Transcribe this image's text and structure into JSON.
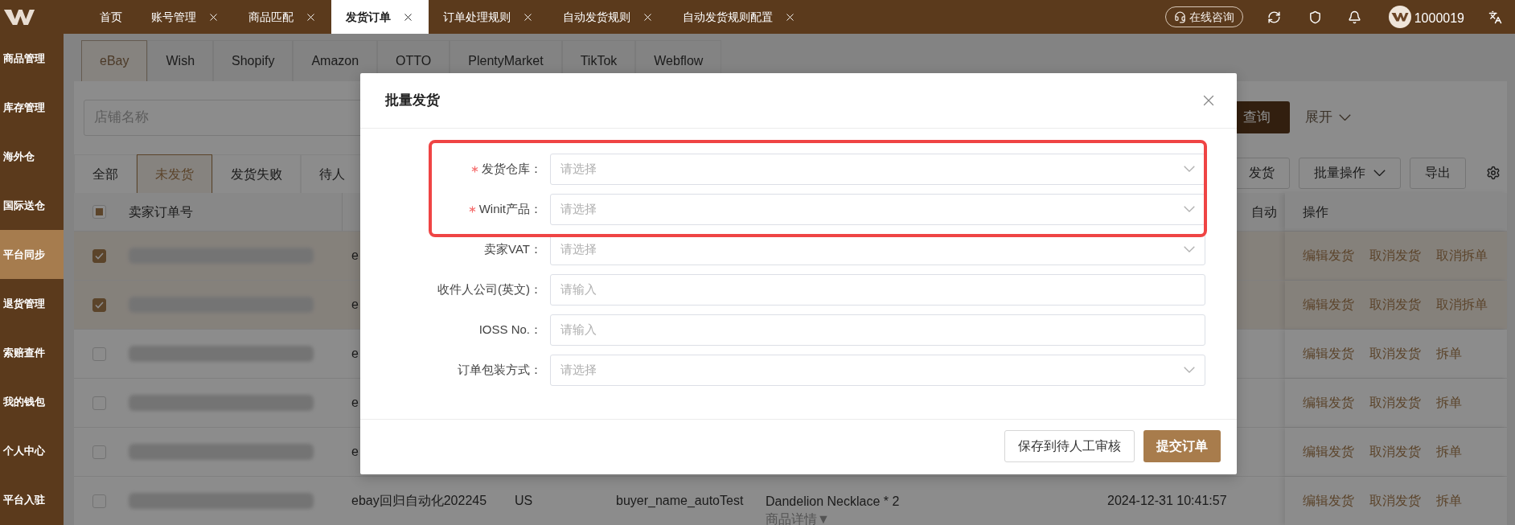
{
  "header": {
    "tabs": [
      {
        "label": "首页",
        "closable": false,
        "selected": false
      },
      {
        "label": "账号管理",
        "closable": true,
        "selected": false
      },
      {
        "label": "商品匹配",
        "closable": true,
        "selected": false
      },
      {
        "label": "发货订单",
        "closable": true,
        "selected": true
      },
      {
        "label": "订单处理规则",
        "closable": true,
        "selected": false
      },
      {
        "label": "自动发货规则",
        "closable": true,
        "selected": false
      },
      {
        "label": "自动发货规则配置",
        "closable": true,
        "selected": false
      }
    ],
    "consult_button": "在线咨询",
    "user_id": "1000019"
  },
  "sidebar": {
    "items": [
      {
        "label": "商品管理",
        "selected": false
      },
      {
        "label": "库存管理",
        "selected": false
      },
      {
        "label": "海外仓",
        "selected": false
      },
      {
        "label": "国际送仓",
        "selected": false
      },
      {
        "label": "平台同步",
        "selected": true
      },
      {
        "label": "退货管理",
        "selected": false
      },
      {
        "label": "索赔查件",
        "selected": false
      },
      {
        "label": "我的钱包",
        "selected": false
      },
      {
        "label": "个人中心",
        "selected": false
      },
      {
        "label": "平台入驻",
        "selected": false
      }
    ]
  },
  "platform_tabs": [
    {
      "label": "eBay",
      "selected": true
    },
    {
      "label": "Wish",
      "selected": false
    },
    {
      "label": "Shopify",
      "selected": false
    },
    {
      "label": "Amazon",
      "selected": false
    },
    {
      "label": "OTTO",
      "selected": false
    },
    {
      "label": "PlentyMarket",
      "selected": false
    },
    {
      "label": "TikTok",
      "selected": false
    },
    {
      "label": "Webflow",
      "selected": false
    }
  ],
  "search": {
    "placeholder": "店铺名称",
    "query_button": "查询",
    "expand_button": "展开"
  },
  "status_tabs": [
    {
      "label": "全部",
      "selected": false
    },
    {
      "label": "未发货",
      "selected": true
    },
    {
      "label": "发货失败",
      "selected": false
    },
    {
      "label": "待人",
      "selected": false
    }
  ],
  "toolbar": [
    {
      "label": "发货",
      "kind": "plain"
    },
    {
      "label": "批量操作",
      "kind": "dropdown"
    },
    {
      "label": "导出",
      "kind": "plain"
    }
  ],
  "table": {
    "select_all_partial": true,
    "columns": [
      {
        "label": "卖家订单号",
        "kind": "order"
      },
      {
        "label": "自动",
        "kind": "auto"
      },
      {
        "label": "操作",
        "kind": "actions"
      }
    ],
    "rows": [
      {
        "checked": true,
        "shop": "e",
        "actions": [
          "编辑发货",
          "取消发货",
          "取消拆单"
        ]
      },
      {
        "checked": true,
        "shop": "e",
        "actions": [
          "编辑发货",
          "取消发货",
          "取消拆单"
        ]
      },
      {
        "checked": false,
        "shop": "e",
        "actions": [
          "编辑发货",
          "取消发货",
          "拆单"
        ]
      },
      {
        "checked": false,
        "shop": "e",
        "actions": [
          "编辑发货",
          "取消发货",
          "拆单"
        ]
      },
      {
        "checked": false,
        "shop": "e",
        "actions": [
          "编辑发货",
          "取消发货",
          "拆单"
        ]
      },
      {
        "checked": false,
        "shop": "ebay回归自动化202245",
        "country": "US",
        "buyer": "buyer_name_autoTest",
        "product": "Dandelion Necklace * 2",
        "detail_link": "商品详情▼",
        "date": "2024-12-31 10:41:57",
        "actions": [
          "编辑发货",
          "取消发货",
          "拆单"
        ]
      }
    ]
  },
  "dialog": {
    "title": "批量发货",
    "fields": [
      {
        "label": "发货仓库：",
        "required": true,
        "highlighted": true,
        "kind": "select",
        "placeholder": "请选择"
      },
      {
        "label": "Winit产品：",
        "required": true,
        "highlighted": true,
        "kind": "select",
        "placeholder": "请选择"
      },
      {
        "label": "卖家VAT：",
        "required": false,
        "highlighted": false,
        "kind": "select",
        "placeholder": "请选择"
      },
      {
        "label": "收件人公司(英文)：",
        "required": false,
        "highlighted": false,
        "kind": "input",
        "placeholder": "请输入"
      },
      {
        "label": "IOSS No.：",
        "required": false,
        "highlighted": false,
        "kind": "input",
        "placeholder": "请输入"
      },
      {
        "label": "订单包装方式：",
        "required": false,
        "highlighted": false,
        "kind": "select",
        "placeholder": "请选择"
      }
    ],
    "buttons": [
      {
        "label": "保存到待人工审核",
        "kind": "secondary"
      },
      {
        "label": "提交订单",
        "kind": "primary"
      }
    ]
  }
}
